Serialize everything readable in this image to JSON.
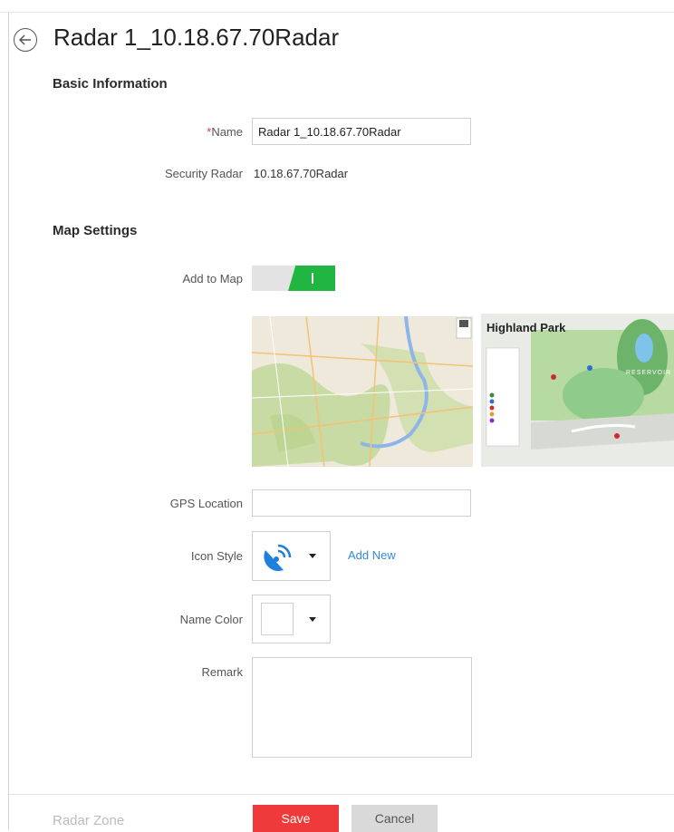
{
  "header": {
    "title": "Radar 1_10.18.67.70Radar"
  },
  "basic_info": {
    "section_title": "Basic Information",
    "name_required_mark": "*",
    "name_label": "Name",
    "name_value": "Radar 1_10.18.67.70Radar",
    "security_radar_label": "Security Radar",
    "security_radar_value": "10.18.67.70Radar"
  },
  "map_settings": {
    "section_title": "Map Settings",
    "add_to_map_label": "Add to Map",
    "add_to_map_on": true,
    "gis_map_thumbnail": "gis-map",
    "e_map_thumbnail": {
      "title": "Highland Park",
      "area_label": "RESERVOIR"
    },
    "gps_label": "GPS Location",
    "gps_value": "",
    "icon_style_label": "Icon Style",
    "icon_style_value": "radar-icon",
    "add_new_label": "Add New",
    "name_color_label": "Name Color",
    "name_color_value": "#ffffff",
    "remark_label": "Remark",
    "remark_value": ""
  },
  "footer": {
    "next_section": "Radar Zone",
    "save_label": "Save",
    "cancel_label": "Cancel"
  },
  "colors": {
    "accent_red": "#ee3a3a",
    "toggle_on": "#21b542",
    "link_blue": "#2e8ae6",
    "icon_blue": "#1f7fd9"
  }
}
